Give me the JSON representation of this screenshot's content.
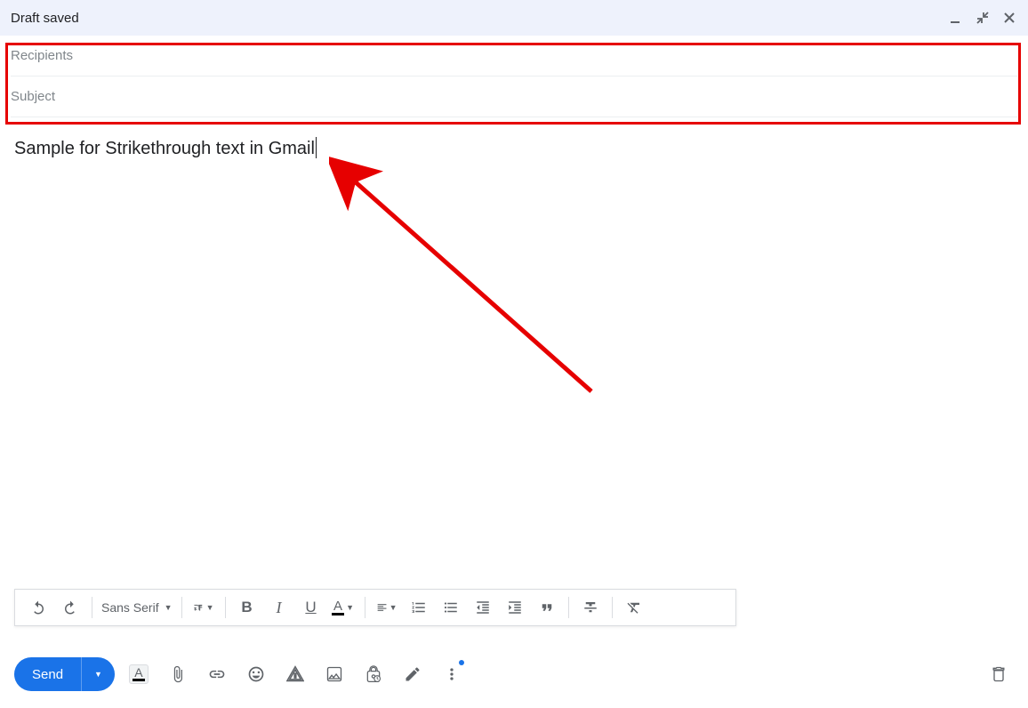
{
  "header": {
    "title": "Draft saved"
  },
  "fields": {
    "recipients_placeholder": "Recipients",
    "subject_placeholder": "Subject"
  },
  "body": {
    "text": "Sample for Strikethrough text in Gmail"
  },
  "toolbar": {
    "font_name": "Sans Serif"
  },
  "send": {
    "label": "Send"
  }
}
